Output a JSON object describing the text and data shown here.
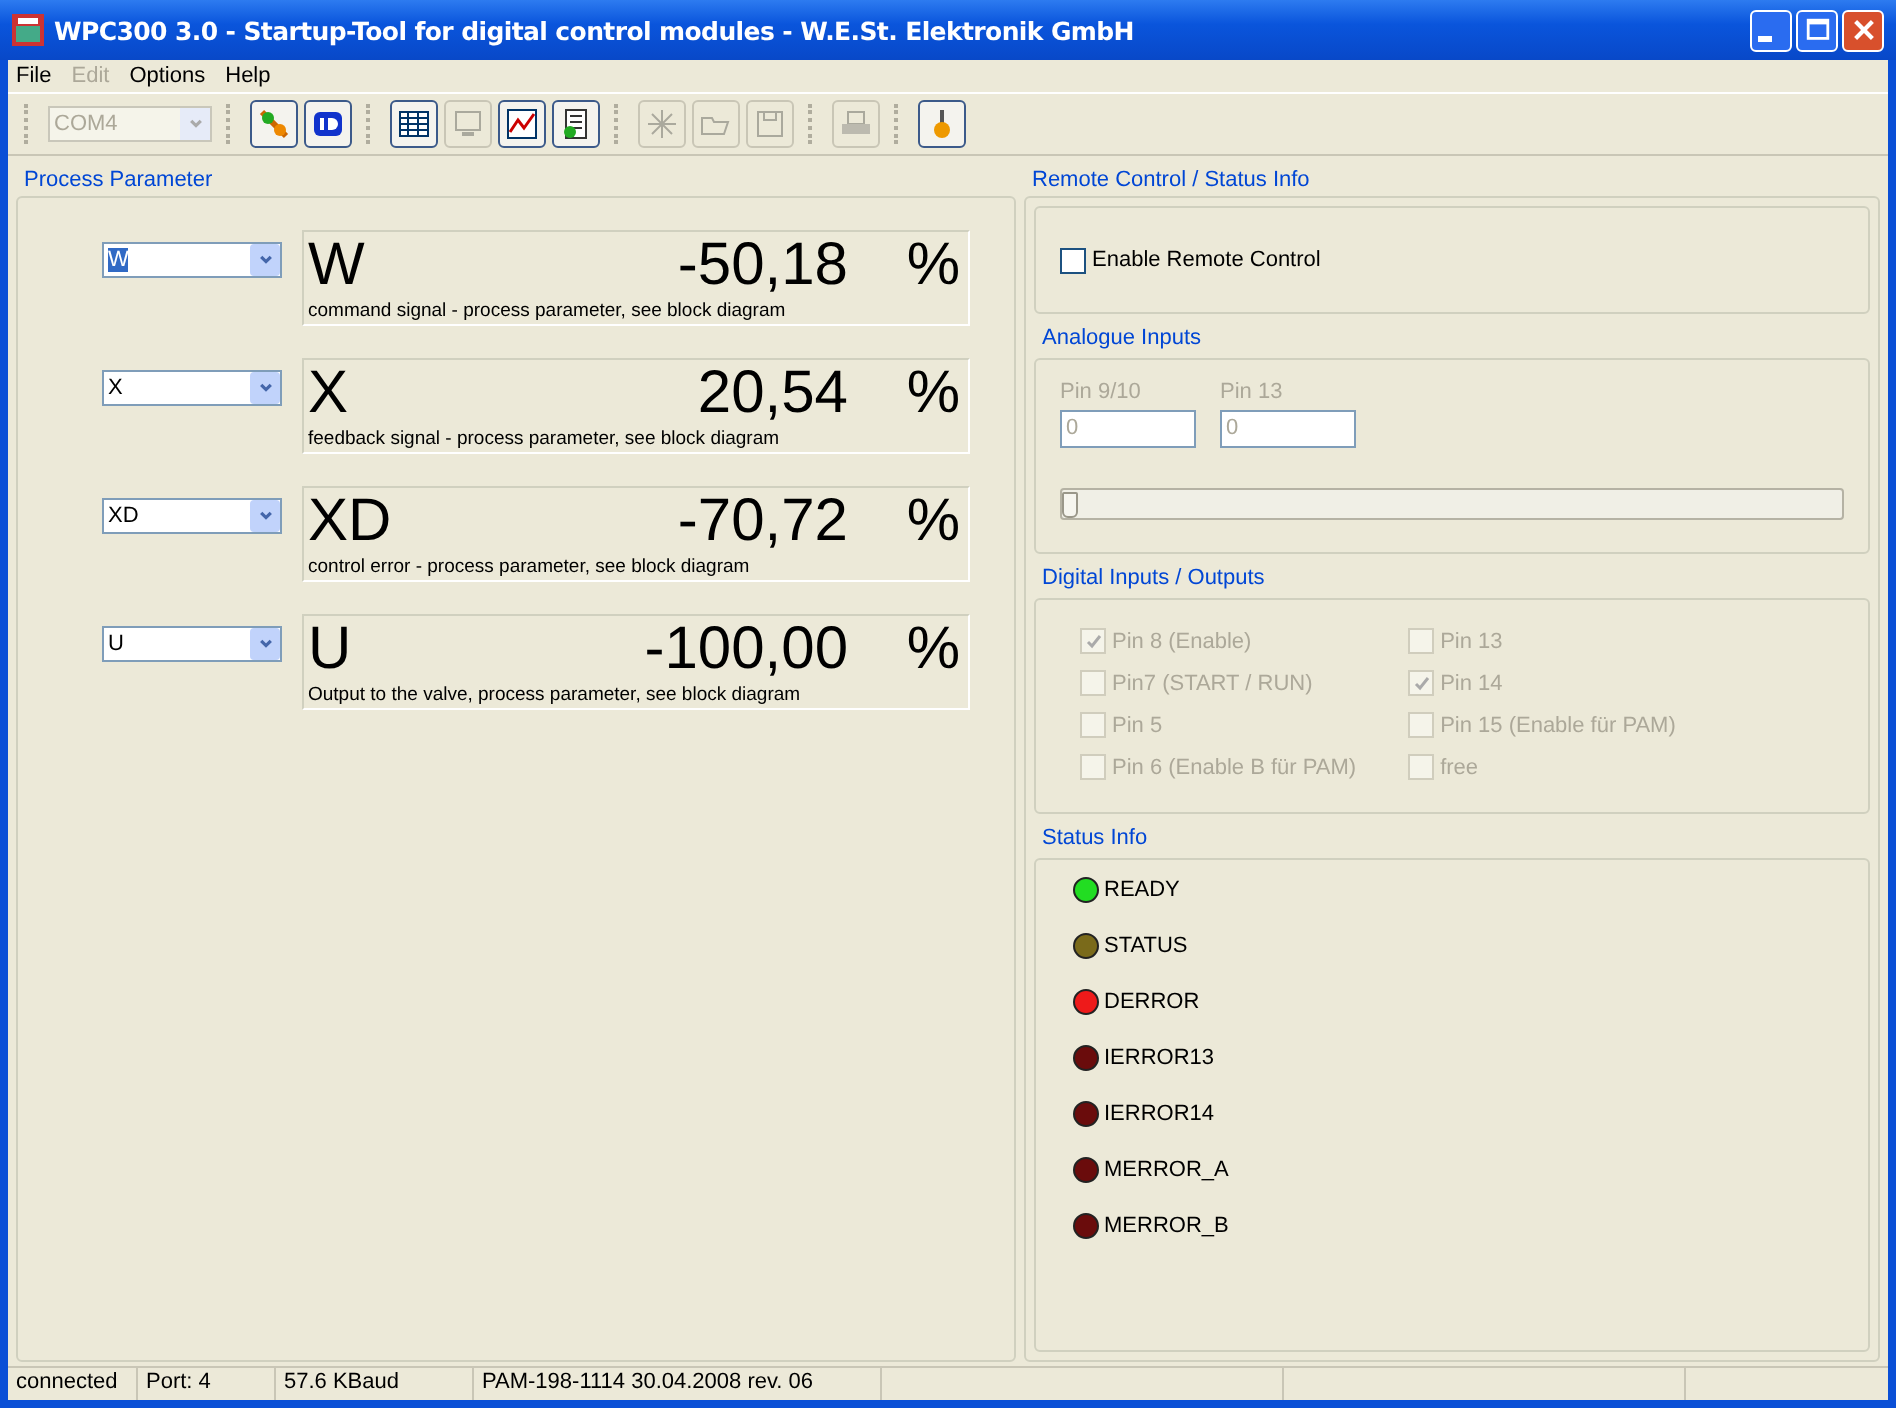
{
  "window": {
    "title": "WPC300 3.0 - Startup-Tool for digital control modules   - W.E.St. Elektronik GmbH"
  },
  "menu": [
    {
      "label": "File",
      "disabled": false
    },
    {
      "label": "Edit",
      "disabled": true
    },
    {
      "label": "Options",
      "disabled": false
    },
    {
      "label": "Help",
      "disabled": false
    }
  ],
  "toolbar": {
    "port": {
      "value": "COM4",
      "disabled": true
    },
    "groups": [
      [
        {
          "kind": "connect",
          "disabled": false
        },
        {
          "kind": "id",
          "disabled": false
        }
      ],
      [
        {
          "kind": "table",
          "disabled": false
        },
        {
          "kind": "monitor",
          "disabled": true
        },
        {
          "kind": "chart",
          "disabled": false
        },
        {
          "kind": "document",
          "disabled": false
        }
      ],
      [
        {
          "kind": "tools",
          "disabled": true
        },
        {
          "kind": "open",
          "disabled": true
        },
        {
          "kind": "save",
          "disabled": true
        }
      ],
      [
        {
          "kind": "print",
          "disabled": true
        }
      ],
      [
        {
          "kind": "settings",
          "disabled": false
        }
      ]
    ]
  },
  "process_parameter": {
    "title": "Process Parameter",
    "rows": [
      {
        "select": "W",
        "highlighted": true,
        "symbol": "W",
        "value": "-50,18",
        "unit": "%",
        "description": "command signal -  process parameter, see block diagram"
      },
      {
        "select": "X",
        "highlighted": false,
        "symbol": "X",
        "value": "20,54",
        "unit": "%",
        "description": "feedback signal -  process parameter, see block diagram"
      },
      {
        "select": "XD",
        "highlighted": false,
        "symbol": "XD",
        "value": "-70,72",
        "unit": "%",
        "description": "control error -  process parameter, see block diagram"
      },
      {
        "select": "U",
        "highlighted": false,
        "symbol": "U",
        "value": "-100,00",
        "unit": "%",
        "description": "Output to the valve, process parameter, see block diagram"
      }
    ]
  },
  "remote_control": {
    "title": "Remote Control / Status Info",
    "enable": {
      "label": "Enable Remote Control",
      "checked": false
    }
  },
  "analogue_inputs": {
    "title": "Analogue Inputs",
    "fields": [
      {
        "label": "Pin 9/10",
        "value": "0"
      },
      {
        "label": "Pin 13",
        "value": "0"
      }
    ],
    "slider": {
      "level": 0,
      "disabled": true
    }
  },
  "digital_io": {
    "title": "Digital Inputs / Outputs",
    "columns": [
      [
        {
          "label": "Pin 8 (Enable)",
          "checked": true,
          "disabled": true
        },
        {
          "label": "Pin7 (START / RUN)",
          "checked": false,
          "disabled": true
        },
        {
          "label": "Pin 5",
          "checked": false,
          "disabled": true
        },
        {
          "label": "Pin 6 (Enable B für PAM)",
          "checked": false,
          "disabled": true
        }
      ],
      [
        {
          "label": "Pin 13",
          "checked": false,
          "disabled": true
        },
        {
          "label": "Pin 14",
          "checked": true,
          "disabled": true
        },
        {
          "label": "Pin 15 (Enable für PAM)",
          "checked": false,
          "disabled": true
        },
        {
          "label": "free",
          "checked": false,
          "disabled": true
        }
      ]
    ]
  },
  "status_info": {
    "title": "Status Info",
    "leds": [
      {
        "label": "READY",
        "color": "#22dd22"
      },
      {
        "label": "STATUS",
        "color": "#7a6a1a"
      },
      {
        "label": "DERROR",
        "color": "#ee1a1a"
      },
      {
        "label": "IERROR13",
        "color": "#6a0c0c"
      },
      {
        "label": "IERROR14",
        "color": "#6a0c0c"
      },
      {
        "label": "MERROR_A",
        "color": "#6a0c0c"
      },
      {
        "label": "MERROR_B",
        "color": "#6a0c0c"
      }
    ]
  },
  "status_bar": [
    "connected",
    "Port: 4",
    "57.6 KBaud",
    "PAM-198-1114 30.04.2008 rev. 06"
  ]
}
